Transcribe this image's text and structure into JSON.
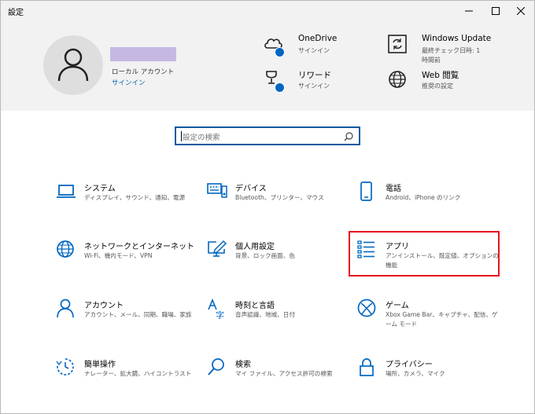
{
  "window": {
    "title": "設定"
  },
  "account": {
    "type_label": "ローカル アカウント",
    "signin_label": "サインイン"
  },
  "header_items": [
    {
      "title": "OneDrive",
      "subtitle": "サインイン",
      "icon": "cloud-icon"
    },
    {
      "title": "Windows Update",
      "subtitle": "最終チェック日時: 1 時間前",
      "icon": "update-icon"
    },
    {
      "title": "リワード",
      "subtitle": "サインイン",
      "icon": "trophy-icon"
    },
    {
      "title": "Web 閲覧",
      "subtitle": "推奨の設定",
      "icon": "globe-icon"
    }
  ],
  "search": {
    "placeholder": "設定の検索"
  },
  "categories": [
    {
      "title": "システム",
      "subtitle": "ディスプレイ、サウンド、通知、電源",
      "icon": "laptop-icon"
    },
    {
      "title": "デバイス",
      "subtitle": "Bluetooth、プリンター、マウス",
      "icon": "keyboard-icon"
    },
    {
      "title": "電話",
      "subtitle": "Android、iPhone のリンク",
      "icon": "phone-icon"
    },
    {
      "title": "ネットワークとインターネット",
      "subtitle": "Wi-Fi、機内モード、VPN",
      "icon": "globe-icon"
    },
    {
      "title": "個人用設定",
      "subtitle": "背景、ロック画面、色",
      "icon": "personalize-icon"
    },
    {
      "title": "アプリ",
      "subtitle": "アンインストール、既定値、オプションの機能",
      "icon": "apps-list-icon"
    },
    {
      "title": "アカウント",
      "subtitle": "アカウント、メール、同期、職場、家族",
      "icon": "person-icon"
    },
    {
      "title": "時刻と言語",
      "subtitle": "音声認識、地域、日付",
      "icon": "time-language-icon"
    },
    {
      "title": "ゲーム",
      "subtitle": "Xbox Game Bar、キャプチャ、配信、ゲーム モード",
      "icon": "xbox-icon"
    },
    {
      "title": "簡単操作",
      "subtitle": "ナレーター、拡大鏡、ハイコントラスト",
      "icon": "ease-of-access-icon"
    },
    {
      "title": "検索",
      "subtitle": "マイ ファイル、アクセス許可の検索",
      "icon": "search-icon"
    },
    {
      "title": "プライバシー",
      "subtitle": "場所、カメラ、マイク",
      "icon": "lock-icon"
    }
  ],
  "colors": {
    "accent": "#0067c0",
    "header_bg": "#f2f2f2",
    "highlight": "#e5141e"
  }
}
